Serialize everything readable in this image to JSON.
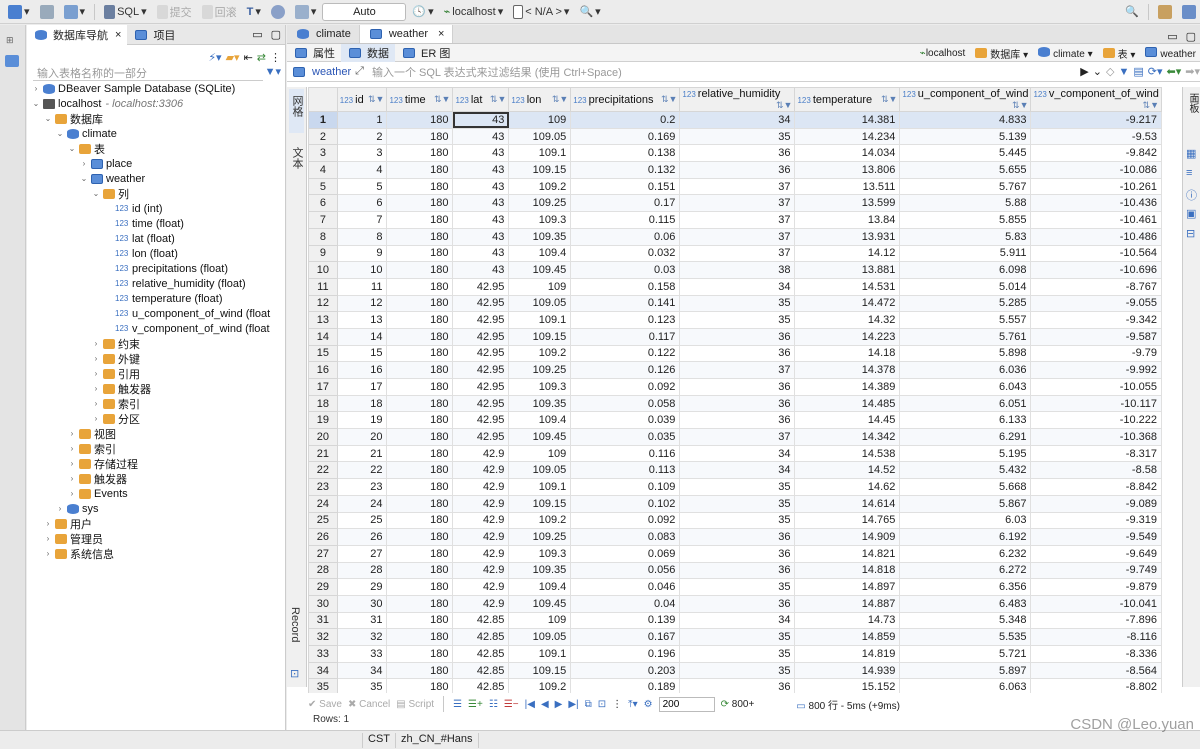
{
  "toolbar": {
    "sql_label": "SQL",
    "commit_label": "提交",
    "rollback_label": "回滚",
    "tx_mode": "Auto",
    "connection": "localhost",
    "schema": "< N/A >"
  },
  "navigator": {
    "tab_db_nav": "数据库导航",
    "tab_projects": "项目",
    "filter_placeholder": "输入表格名称的一部分",
    "tree": {
      "sample_db": "DBeaver Sample Database (SQLite)",
      "localhost": "localhost",
      "localhost_sub": "- localhost:3306",
      "databases": "数据库",
      "climate": "climate",
      "tables": "表",
      "place": "place",
      "weather": "weather",
      "columns": "列",
      "cols": [
        "id (int)",
        "time (float)",
        "lat (float)",
        "lon (float)",
        "precipitations (float)",
        "relative_humidity (float)",
        "temperature (float)",
        "u_component_of_wind (float",
        "v_component_of_wind (float"
      ],
      "constraints": "约束",
      "foreign_keys": "外键",
      "references": "引用",
      "triggers": "触发器",
      "indexes": "索引",
      "partitions": "分区",
      "views": "视图",
      "db_indexes": "索引",
      "procedures": "存储过程",
      "db_triggers": "触发器",
      "events": "Events",
      "sys": "sys",
      "users": "用户",
      "admin": "管理员",
      "sysinfo": "系统信息"
    }
  },
  "editor": {
    "tabs": [
      "climate",
      "weather"
    ],
    "subtabs": [
      "属性",
      "数据",
      "ER 图"
    ],
    "crumbs": [
      "localhost",
      "数据库",
      "climate",
      "表",
      "weather"
    ],
    "filter_table": "weather",
    "filter_hint": "输入一个 SQL 表达式来过滤结果 (使用 Ctrl+Space)",
    "vtab_grid": "网格",
    "vtab_text": "文本",
    "vtab_record": "Record",
    "rside_panel": "面板",
    "columns": [
      "id",
      "time",
      "lat",
      "lon",
      "precipitations",
      "relative_humidity",
      "temperature",
      "u_component_of_wind",
      "v_component_of_wind"
    ],
    "rows": [
      [
        "1",
        "180",
        "43",
        "109",
        "0.2",
        "34",
        "14.381",
        "4.833",
        "-9.217"
      ],
      [
        "2",
        "180",
        "43",
        "109.05",
        "0.169",
        "35",
        "14.234",
        "5.139",
        "-9.53"
      ],
      [
        "3",
        "180",
        "43",
        "109.1",
        "0.138",
        "36",
        "14.034",
        "5.445",
        "-9.842"
      ],
      [
        "4",
        "180",
        "43",
        "109.15",
        "0.132",
        "36",
        "13.806",
        "5.655",
        "-10.086"
      ],
      [
        "5",
        "180",
        "43",
        "109.2",
        "0.151",
        "37",
        "13.511",
        "5.767",
        "-10.261"
      ],
      [
        "6",
        "180",
        "43",
        "109.25",
        "0.17",
        "37",
        "13.599",
        "5.88",
        "-10.436"
      ],
      [
        "7",
        "180",
        "43",
        "109.3",
        "0.115",
        "37",
        "13.84",
        "5.855",
        "-10.461"
      ],
      [
        "8",
        "180",
        "43",
        "109.35",
        "0.06",
        "37",
        "13.931",
        "5.83",
        "-10.486"
      ],
      [
        "9",
        "180",
        "43",
        "109.4",
        "0.032",
        "37",
        "14.12",
        "5.911",
        "-10.564"
      ],
      [
        "10",
        "180",
        "43",
        "109.45",
        "0.03",
        "38",
        "13.881",
        "6.098",
        "-10.696"
      ],
      [
        "11",
        "180",
        "42.95",
        "109",
        "0.158",
        "34",
        "14.531",
        "5.014",
        "-8.767"
      ],
      [
        "12",
        "180",
        "42.95",
        "109.05",
        "0.141",
        "35",
        "14.472",
        "5.285",
        "-9.055"
      ],
      [
        "13",
        "180",
        "42.95",
        "109.1",
        "0.123",
        "35",
        "14.32",
        "5.557",
        "-9.342"
      ],
      [
        "14",
        "180",
        "42.95",
        "109.15",
        "0.117",
        "36",
        "14.223",
        "5.761",
        "-9.587"
      ],
      [
        "15",
        "180",
        "42.95",
        "109.2",
        "0.122",
        "36",
        "14.18",
        "5.898",
        "-9.79"
      ],
      [
        "16",
        "180",
        "42.95",
        "109.25",
        "0.126",
        "37",
        "14.378",
        "6.036",
        "-9.992"
      ],
      [
        "17",
        "180",
        "42.95",
        "109.3",
        "0.092",
        "36",
        "14.389",
        "6.043",
        "-10.055"
      ],
      [
        "18",
        "180",
        "42.95",
        "109.35",
        "0.058",
        "36",
        "14.485",
        "6.051",
        "-10.117"
      ],
      [
        "19",
        "180",
        "42.95",
        "109.4",
        "0.039",
        "36",
        "14.45",
        "6.133",
        "-10.222"
      ],
      [
        "20",
        "180",
        "42.95",
        "109.45",
        "0.035",
        "37",
        "14.342",
        "6.291",
        "-10.368"
      ],
      [
        "21",
        "180",
        "42.9",
        "109",
        "0.116",
        "34",
        "14.538",
        "5.195",
        "-8.317"
      ],
      [
        "22",
        "180",
        "42.9",
        "109.05",
        "0.113",
        "34",
        "14.52",
        "5.432",
        "-8.58"
      ],
      [
        "23",
        "180",
        "42.9",
        "109.1",
        "0.109",
        "35",
        "14.62",
        "5.668",
        "-8.842"
      ],
      [
        "24",
        "180",
        "42.9",
        "109.15",
        "0.102",
        "35",
        "14.614",
        "5.867",
        "-9.089"
      ],
      [
        "25",
        "180",
        "42.9",
        "109.2",
        "0.092",
        "35",
        "14.765",
        "6.03",
        "-9.319"
      ],
      [
        "26",
        "180",
        "42.9",
        "109.25",
        "0.083",
        "36",
        "14.909",
        "6.192",
        "-9.549"
      ],
      [
        "27",
        "180",
        "42.9",
        "109.3",
        "0.069",
        "36",
        "14.821",
        "6.232",
        "-9.649"
      ],
      [
        "28",
        "180",
        "42.9",
        "109.35",
        "0.056",
        "36",
        "14.818",
        "6.272",
        "-9.749"
      ],
      [
        "29",
        "180",
        "42.9",
        "109.4",
        "0.046",
        "35",
        "14.897",
        "6.356",
        "-9.879"
      ],
      [
        "30",
        "180",
        "42.9",
        "109.45",
        "0.04",
        "36",
        "14.887",
        "6.483",
        "-10.041"
      ],
      [
        "31",
        "180",
        "42.85",
        "109",
        "0.139",
        "34",
        "14.73",
        "5.348",
        "-7.896"
      ],
      [
        "32",
        "180",
        "42.85",
        "109.05",
        "0.167",
        "35",
        "14.859",
        "5.535",
        "-8.116"
      ],
      [
        "33",
        "180",
        "42.85",
        "109.1",
        "0.196",
        "35",
        "14.819",
        "5.721",
        "-8.336"
      ],
      [
        "34",
        "180",
        "42.85",
        "109.15",
        "0.203",
        "35",
        "14.939",
        "5.897",
        "-8.564"
      ],
      [
        "35",
        "180",
        "42.85",
        "109.2",
        "0.189",
        "36",
        "15.152",
        "6.063",
        "-8.802"
      ]
    ],
    "bottom": {
      "save": "Save",
      "cancel": "Cancel",
      "script": "Script",
      "fetch_size": "200",
      "fetch_more": "800+",
      "summary": "800 行 - 5ms (+9ms)",
      "rows_line": "Rows: 1"
    }
  },
  "status": {
    "tz": "CST",
    "locale": "zh_CN_#Hans"
  },
  "watermark": "CSDN @Leo.yuan"
}
